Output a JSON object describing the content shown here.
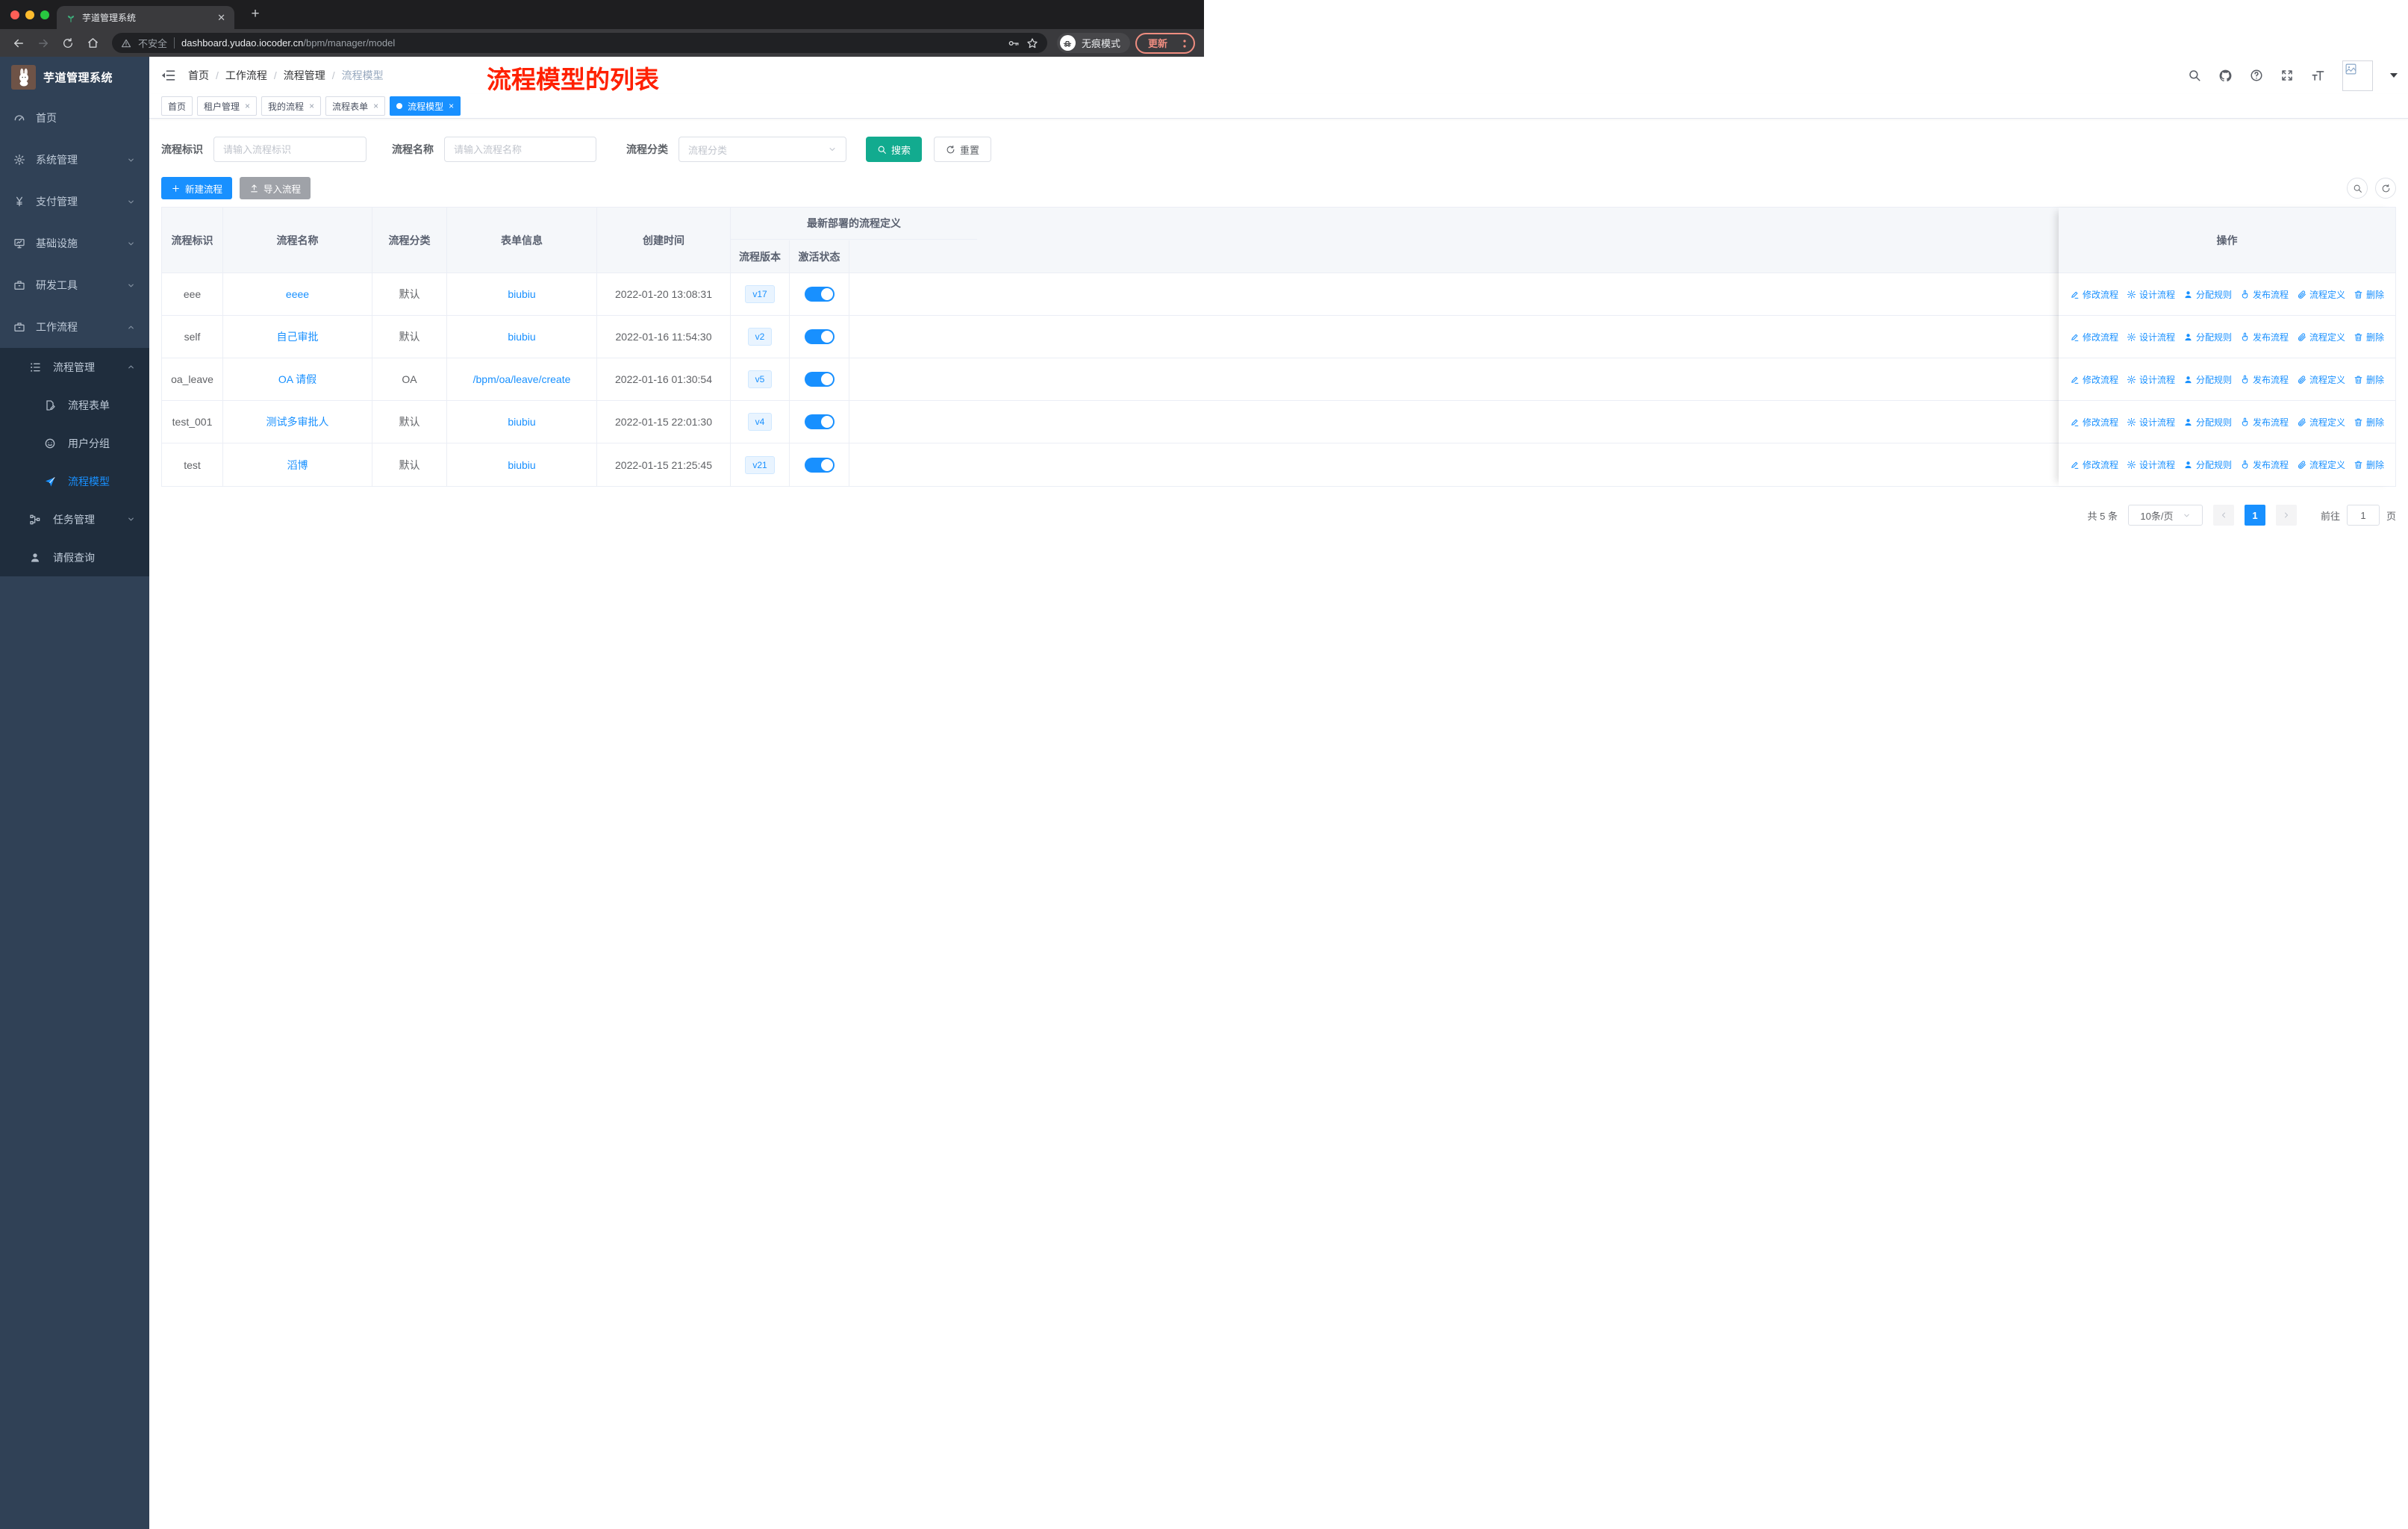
{
  "browser": {
    "tab_title": "芋道管理系统",
    "close_tab": "✕",
    "new_tab": "+",
    "security_label": "不安全",
    "url_host": "dashboard.yudao.iocoder.cn",
    "url_path": "/bpm/manager/model",
    "incognito_label": "无痕模式",
    "update_label": "更新"
  },
  "sidebar": {
    "logo_title": "芋道管理系统",
    "items": [
      {
        "id": "home",
        "label": "首页",
        "icon": "i-gauge",
        "level": 1
      },
      {
        "id": "system",
        "label": "系统管理",
        "icon": "i-gear",
        "level": 1,
        "arrow": "down"
      },
      {
        "id": "payment",
        "label": "支付管理",
        "icon": "i-yen",
        "level": 1,
        "arrow": "down"
      },
      {
        "id": "infra",
        "label": "基础设施",
        "icon": "i-monitor",
        "level": 1,
        "arrow": "down"
      },
      {
        "id": "devtools",
        "label": "研发工具",
        "icon": "i-case",
        "level": 1,
        "arrow": "down"
      },
      {
        "id": "workflow",
        "label": "工作流程",
        "icon": "i-case",
        "level": 1,
        "arrow": "up"
      },
      {
        "id": "process-mgmt",
        "label": "流程管理",
        "icon": "i-list",
        "level": 2,
        "sub": true,
        "arrow": "up"
      },
      {
        "id": "process-form",
        "label": "流程表单",
        "icon": "i-docedit",
        "level": 3,
        "sub": true
      },
      {
        "id": "user-group",
        "label": "用户分组",
        "icon": "i-face",
        "level": 3,
        "sub": true
      },
      {
        "id": "process-model",
        "label": "流程模型",
        "icon": "i-plane",
        "level": 3,
        "sub": true,
        "active": true
      },
      {
        "id": "task-mgmt",
        "label": "任务管理",
        "icon": "i-tree",
        "level": 2,
        "sub": true,
        "arrow": "down"
      },
      {
        "id": "leave-query",
        "label": "请假查询",
        "icon": "i-person",
        "level": 2,
        "sub": true
      }
    ]
  },
  "header": {
    "breadcrumb": [
      "首页",
      "工作流程",
      "流程管理",
      "流程模型"
    ],
    "annotation": "流程模型的列表"
  },
  "tags": [
    {
      "id": "home",
      "label": "首页",
      "closable": false,
      "active": false
    },
    {
      "id": "tenant",
      "label": "租户管理",
      "closable": true,
      "active": false
    },
    {
      "id": "my-process",
      "label": "我的流程",
      "closable": true,
      "active": false
    },
    {
      "id": "process-form",
      "label": "流程表单",
      "closable": true,
      "active": false
    },
    {
      "id": "process-model",
      "label": "流程模型",
      "closable": true,
      "active": true
    }
  ],
  "filters": {
    "key_label": "流程标识",
    "key_placeholder": "请输入流程标识",
    "name_label": "流程名称",
    "name_placeholder": "请输入流程名称",
    "category_label": "流程分类",
    "category_placeholder": "流程分类",
    "search_label": "搜索",
    "reset_label": "重置"
  },
  "toolbar": {
    "create_label": "新建流程",
    "import_label": "导入流程"
  },
  "table": {
    "columns": [
      "流程标识",
      "流程名称",
      "流程分类",
      "表单信息",
      "创建时间"
    ],
    "group_header": "最新部署的流程定义",
    "sub_columns": [
      "流程版本",
      "激活状态"
    ],
    "op_header": "操作",
    "actions": [
      {
        "id": "edit",
        "label": "修改流程",
        "icon": "i-edit"
      },
      {
        "id": "design",
        "label": "设计流程",
        "icon": "i-gear"
      },
      {
        "id": "assign",
        "label": "分配规则",
        "icon": "i-user"
      },
      {
        "id": "publish",
        "label": "发布流程",
        "icon": "i-hand"
      },
      {
        "id": "definition",
        "label": "流程定义",
        "icon": "i-clip"
      },
      {
        "id": "delete",
        "label": "删除",
        "icon": "i-trash"
      }
    ],
    "rows": [
      {
        "key": "eee",
        "name": "eeee",
        "category": "默认",
        "form": "biubiu",
        "created": "2022-01-20 13:08:31",
        "version": "v17",
        "active": true
      },
      {
        "key": "self",
        "name": "自己审批",
        "category": "默认",
        "form": "biubiu",
        "created": "2022-01-16 11:54:30",
        "version": "v2",
        "active": true
      },
      {
        "key": "oa_leave",
        "name": "OA 请假",
        "category": "OA",
        "form": "/bpm/oa/leave/create",
        "created": "2022-01-16 01:30:54",
        "version": "v5",
        "active": true
      },
      {
        "key": "test_001",
        "name": "测试多审批人",
        "category": "默认",
        "form": "biubiu",
        "created": "2022-01-15 22:01:30",
        "version": "v4",
        "active": true
      },
      {
        "key": "test",
        "name": "滔博",
        "category": "默认",
        "form": "biubiu",
        "created": "2022-01-15 21:25:45",
        "version": "v21",
        "active": true
      }
    ]
  },
  "pagination": {
    "total_label": "共 5 条",
    "page_size": "10条/页",
    "current_page": "1",
    "goto_label": "前往",
    "goto_value": "1",
    "page_suffix": "页"
  },
  "colors": {
    "accent_blue": "#1890ff",
    "search_teal": "#12ab8f",
    "annotation_red": "#ff2000",
    "sidebar_bg": "#304156",
    "submenu_bg": "#1f2d3d"
  }
}
